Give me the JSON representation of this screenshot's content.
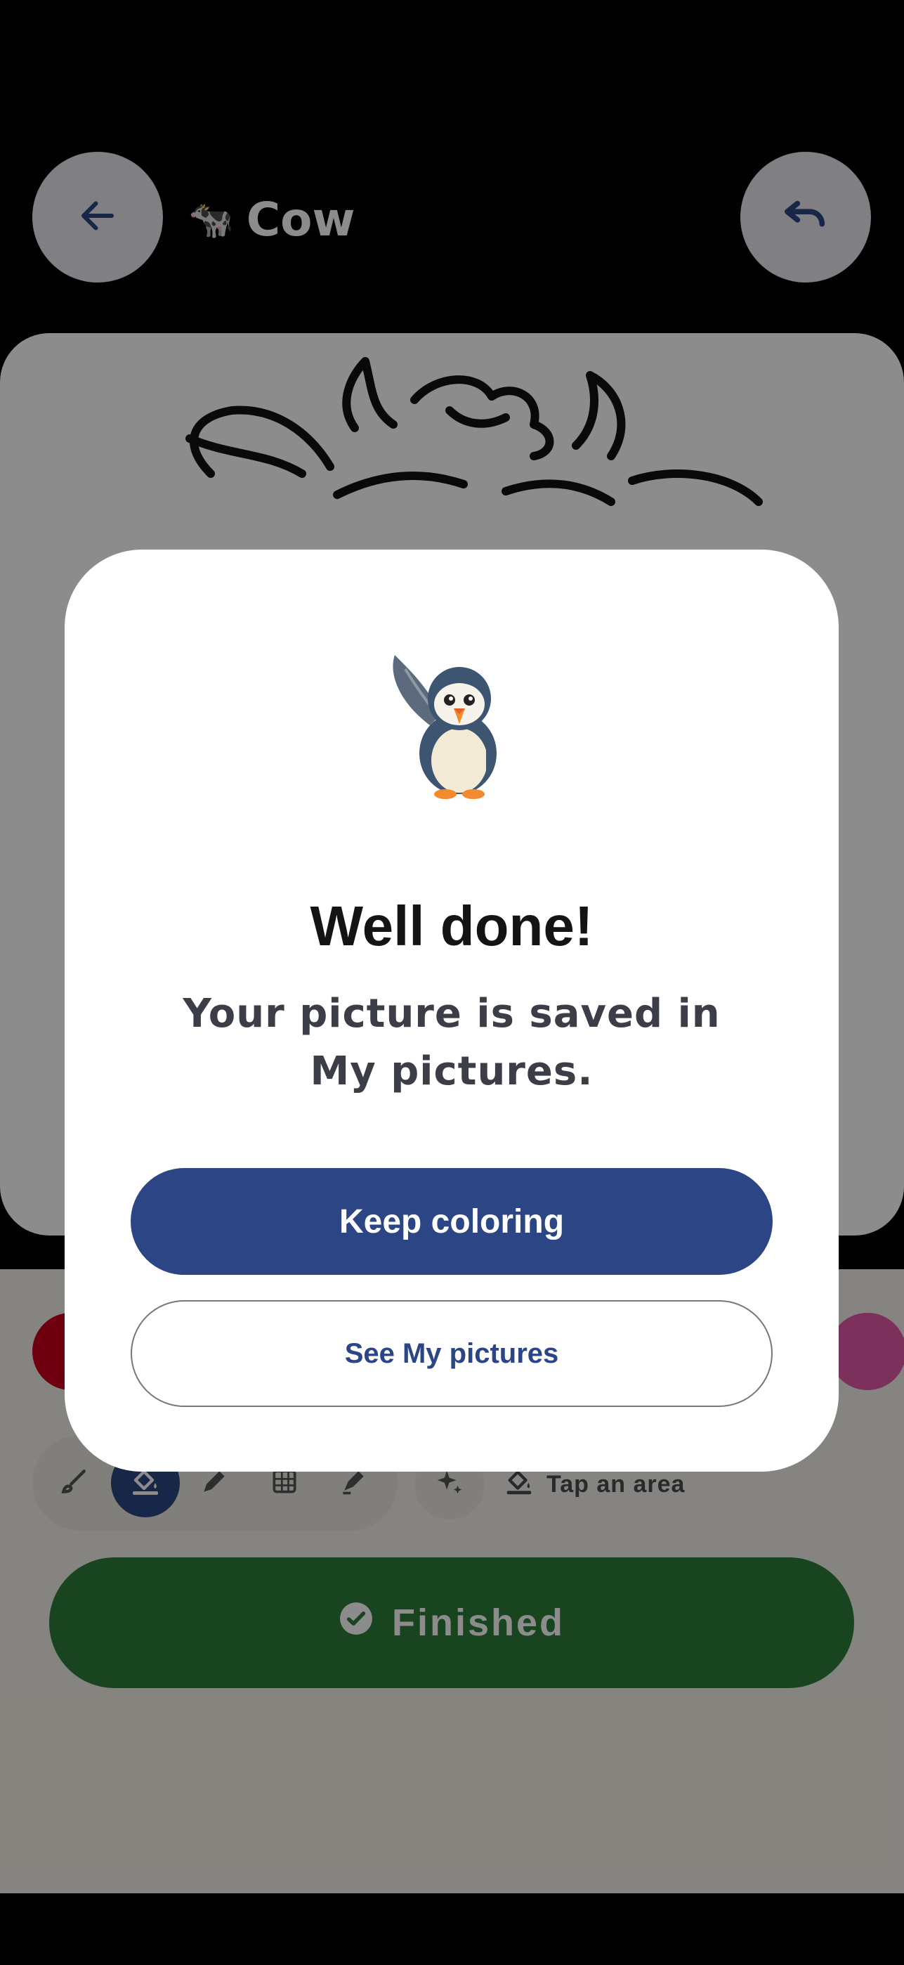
{
  "header": {
    "back_icon": "arrow-left-icon",
    "title_emoji": "🐄",
    "title": "Cow",
    "undo_icon": "undo-icon"
  },
  "colors": {
    "primary": "#2c4584",
    "finished": "#2f7d3b",
    "modal_bg": "#ffffff"
  },
  "palette": [
    "#c8001e",
    "#e05aa8"
  ],
  "toolbar": {
    "tools": [
      {
        "icon": "brush-icon",
        "active": false
      },
      {
        "icon": "fill-bucket-icon",
        "active": true
      },
      {
        "icon": "pencil-icon",
        "active": false
      },
      {
        "icon": "pattern-icon",
        "active": false
      },
      {
        "icon": "marker-icon",
        "active": false
      }
    ],
    "magic_icon": "sparkle-icon",
    "hint_icon": "fill-bucket-icon",
    "hint": "Tap an area"
  },
  "finished_button": {
    "icon": "check-circle-icon",
    "label": "Finished"
  },
  "dialog": {
    "mascot": "puffin-icon",
    "title": "Well done!",
    "message": "Your picture is saved in My pictures.",
    "primary_label": "Keep coloring",
    "secondary_label": "See My pictures"
  }
}
